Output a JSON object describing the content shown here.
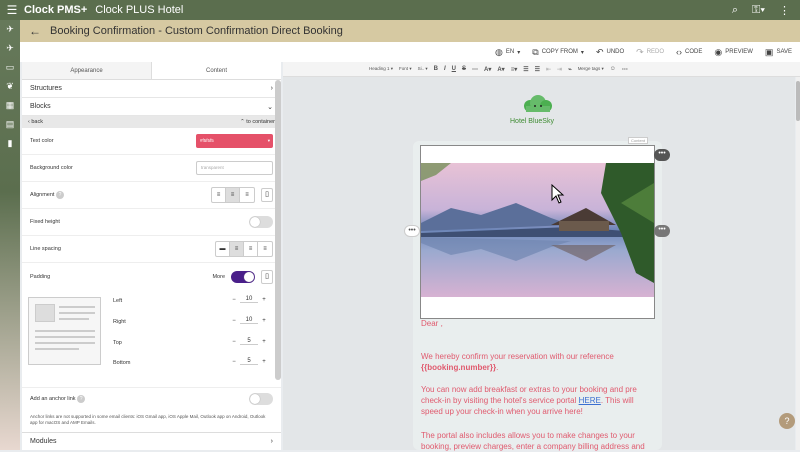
{
  "topbar": {
    "menu_icon": "hamburger-icon",
    "app": "Clock PMS+",
    "hotel": "Clock PLUS Hotel"
  },
  "header": {
    "title": "Booking Confirmation - Custom Confirmation Direct Booking"
  },
  "toolbar": {
    "lang": "EN",
    "copy_from": "COPY FROM",
    "undo": "UNDO",
    "redo": "REDO",
    "code": "CODE",
    "preview": "PREVIEW",
    "save": "SAVE"
  },
  "panel": {
    "tab_appearance": "Appearance",
    "tab_content": "Content",
    "structures": "Structures",
    "blocks": "Blocks",
    "back": "back",
    "to_container": "to container",
    "text_color_label": "Text color",
    "text_color_value": "#f5f5f5",
    "background_color_label": "Background color",
    "background_color_value": "transparent",
    "alignment_label": "Alignment",
    "fixed_height_label": "Fixed height",
    "line_spacing_label": "Line spacing",
    "padding_label": "Padding",
    "more_label": "More",
    "left_label": "Left",
    "left_value": "10",
    "right_label": "Right",
    "right_value": "10",
    "top_label": "Top",
    "top_value": "5",
    "bottom_label": "Bottom",
    "bottom_value": "5",
    "anchor_label": "Add an anchor link",
    "anchor_note": "Anchor links are not supported in some email clients: iOS Gmail app, iOS Apple Mail, Outlook app on Android, Outlook app for macOS and AMP Emails.",
    "modules": "Modules"
  },
  "editor_toolbar": {
    "heading": "Heading 1",
    "font": "Font",
    "size": "Si..",
    "merge_tags": "Merge tags"
  },
  "email": {
    "hotel_name": "Hotel BlueSky",
    "content_label": "Content",
    "dear": "Dear  ,",
    "p1": "We hereby confirm your reservation with our reference",
    "p1_tag": "{{booking.number}}",
    "p1_end": ".",
    "p2a": "You can now add breakfast or extras to your booking and pre check-in by visiting the hotel's service portal ",
    "p2_link": "HERE",
    "p2b": ". This will speed up your check-in when you arrive here!",
    "p3": "The portal also includes allows you to make changes to your booking, preview charges, enter a company billing address and"
  },
  "colors": {
    "accent_green": "#5b6e4e",
    "header_tan": "#d6c9a2",
    "email_text": "#e05a6e",
    "text_color_swatch": "#e55169",
    "toggle_on": "#4a1f8a"
  }
}
